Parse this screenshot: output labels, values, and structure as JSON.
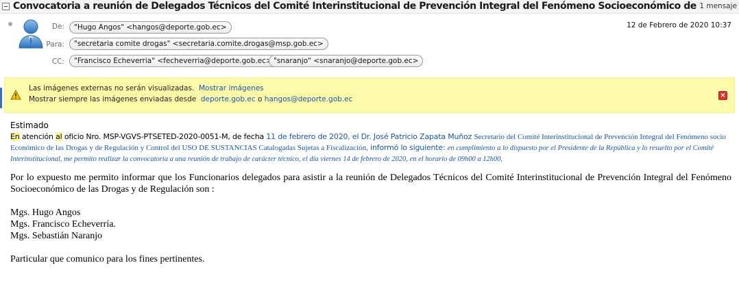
{
  "thread": {
    "subject": "Convocatoria a reunión de Delegados Técnicos del Comité Interinstitucional de Prevención Integral del Fenómeno Socioeconómico de las Drogas",
    "count": "1 mensaje"
  },
  "message": {
    "date": "12 de Febrero de 2020 10:37",
    "from_label": "De:",
    "to_label": "Para:",
    "cc_label": "CC:",
    "from": "\"Hugo Angos\" <hangos@deporte.gob.ec>",
    "to": "\"secretaria comite drogas\" <secretaria.comite.drogas@msp.gob.ec>",
    "cc": [
      "\"Francisco Echeverria\" <fecheverria@deporte.gob.ec>",
      "\"snaranjo\" <snaranjo@deporte.gob.ec>"
    ]
  },
  "warning": {
    "text1": "Las imágenes externas no serán visualizadas.",
    "show_images": "Mostrar imágenes",
    "text2": "Mostrar siempre las imágenes enviadas desde",
    "domain": "deporte.gob.ec",
    "or": "o",
    "sender": "hangos@deporte.gob.ec"
  },
  "body": {
    "greeting": "Estimado",
    "p1_a": "En",
    "p1_b": " atención ",
    "p1_c": "al",
    "p1_d": " oficio  Nro. MSP-VGVS-PTSETED-2020-0051-M, de fecha ",
    "p1_e": "11 de febrero de 2020, el Dr. José Patricio Zapata  Muñoz ",
    "p1_f": "Secretario del Comité Interinstitucional de Prevención Integral del Fenómeno socio Económico de las Drogas y de Regulación y Control del USO DE SUSTANCIAS Catalogadas Sujetas a Fiscalización,",
    "p1_g": "  informó lo siguiente:  ",
    "p1_h": "en cumplimiento a lo dispuesto por el Presidente de la República y lo resuelto por el Comité Interinstitucional, me permito realizar la convocatoria a una reunión de trabajo de carácter técnico, el día viernes 14 de febrero de 2020, en el horario de 09h00 a 12h00,",
    "p2": "Por lo expuesto me permito informar que los  Funcionarios delegados para asistir a la reunión de Delegados Técnicos del Comité Interinstitucional de Prevención Integral del Fenómeno Socioeconómico de las Drogas y de Regulación son :",
    "names": [
      "Mgs. Hugo Angos",
      "Mgs. Francisco Echeverría.",
      "Mgs.  Sebastián Naranjo"
    ],
    "closing": "Particular que comunico para los fines pertinentes."
  }
}
